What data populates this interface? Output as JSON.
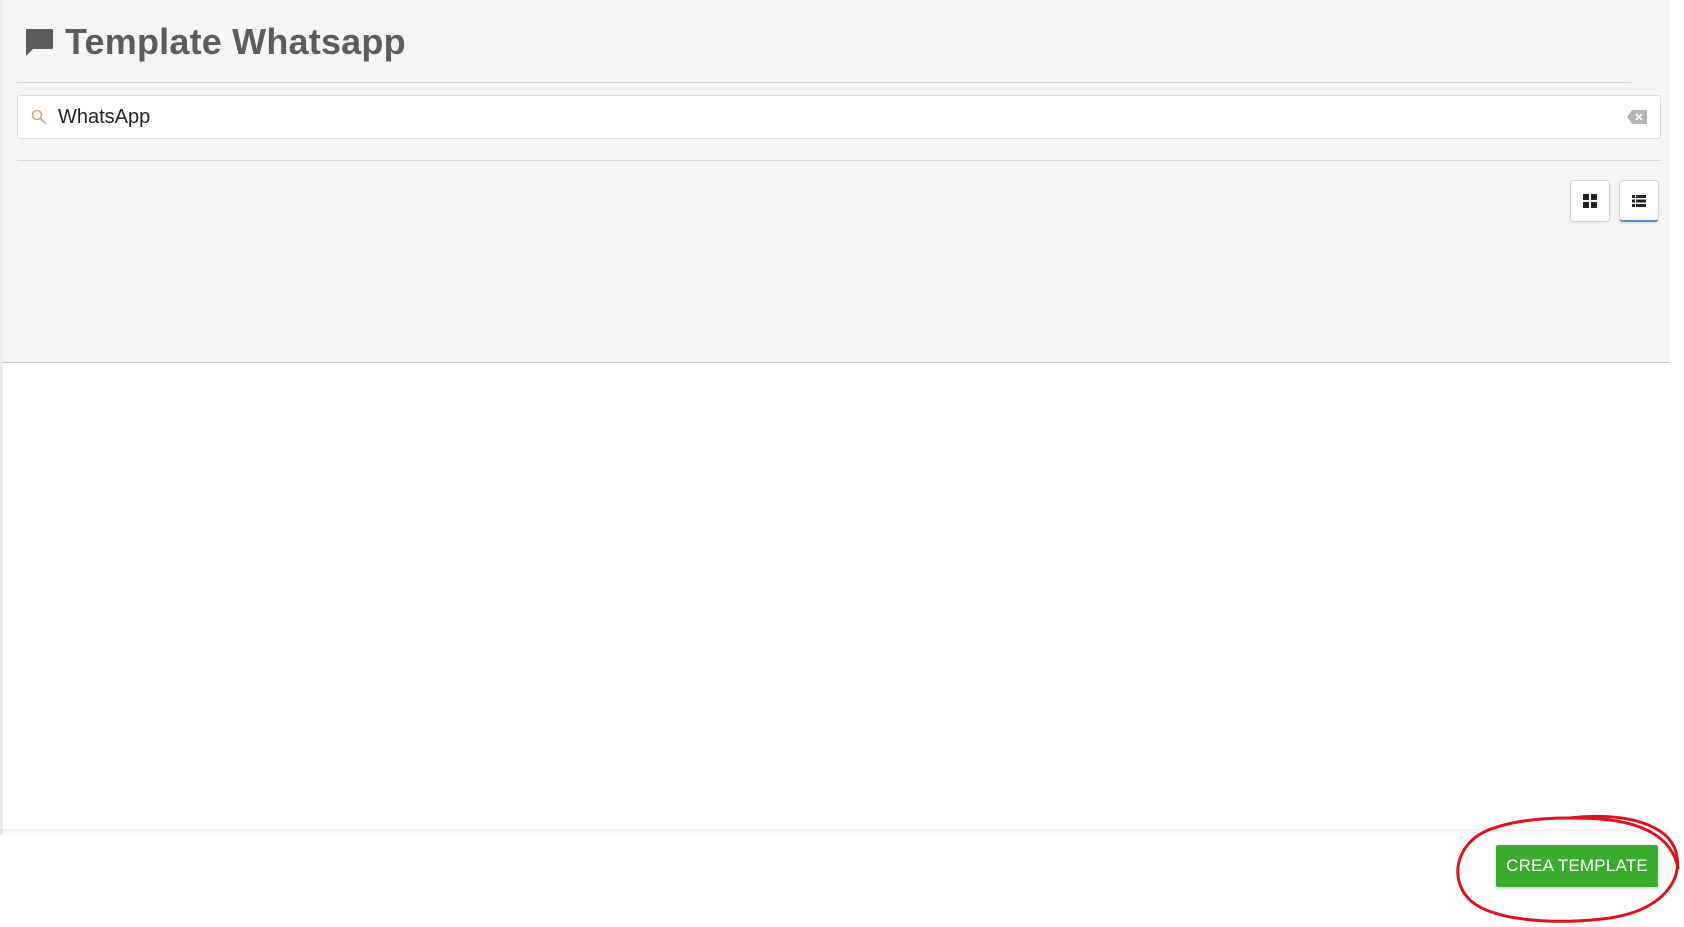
{
  "header": {
    "title": "Template Whatsapp",
    "icon": "chat-bubble-icon"
  },
  "search": {
    "value": "WhatsApp",
    "icon": "search-icon",
    "clear_icon": "backspace-clear-icon"
  },
  "view_toggle": {
    "options": [
      {
        "name": "grid-view",
        "icon": "grid-icon",
        "active": false
      },
      {
        "name": "list-view",
        "icon": "list-icon",
        "active": true
      }
    ]
  },
  "footer": {
    "create_label": "CREA TEMPLATE"
  },
  "colors": {
    "primary_button": "#3aad2e",
    "title_text": "#5c5c5c",
    "panel_background": "#f5f5f5",
    "active_underline": "#4a90d9",
    "annotation_circle": "#e0121b"
  }
}
